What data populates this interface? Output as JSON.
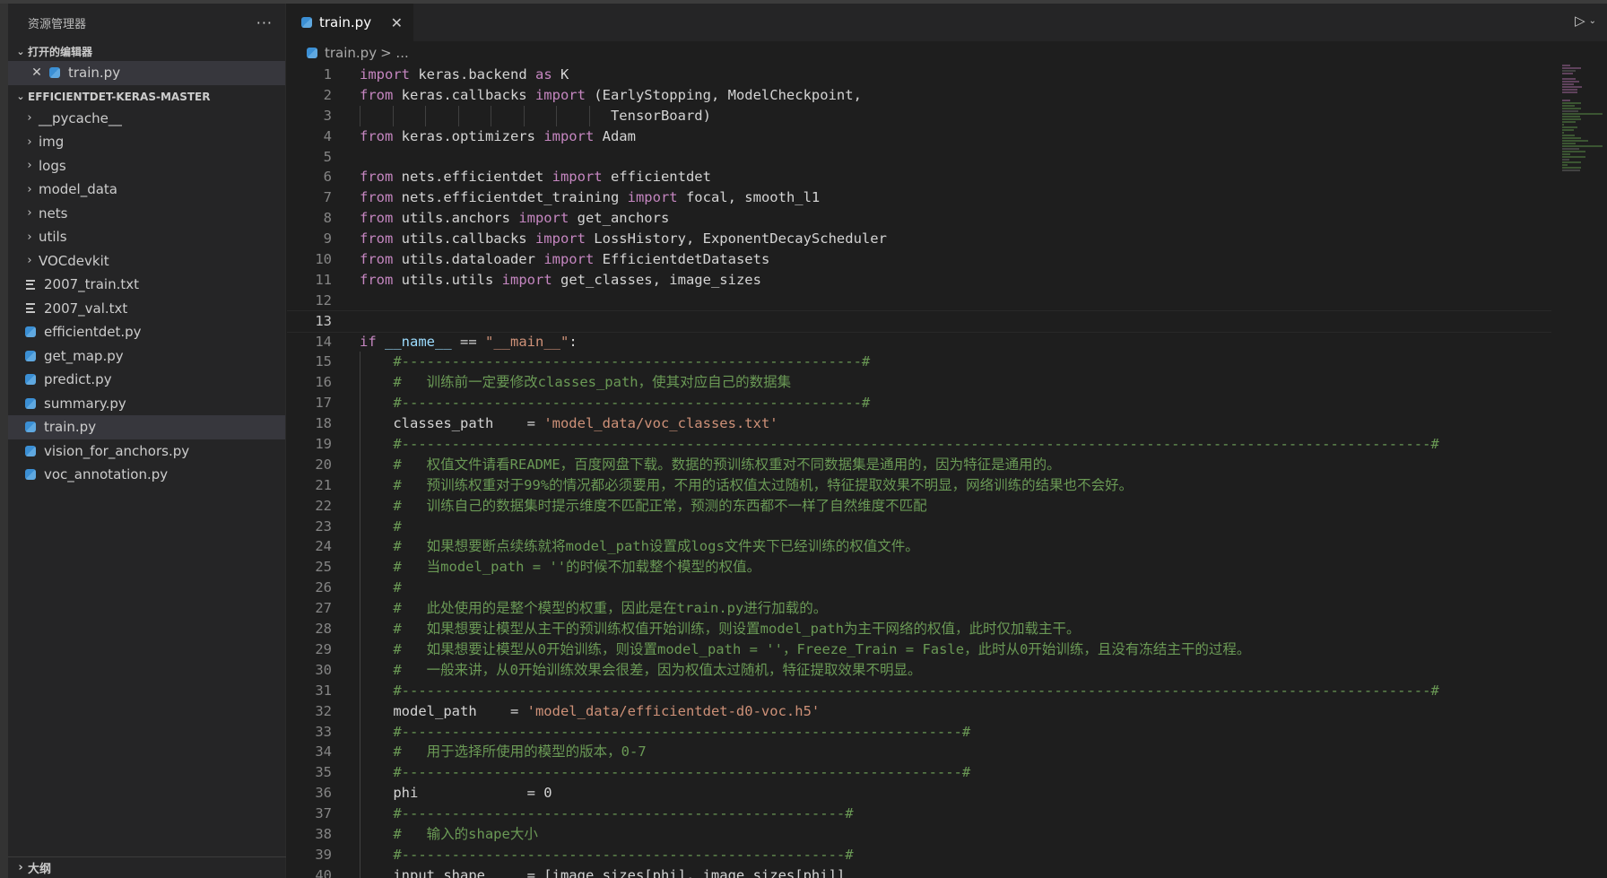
{
  "sidebar": {
    "title": "资源管理器",
    "more": "···",
    "open_editors": {
      "label": "打开的编辑器",
      "items": [
        {
          "name": "train.py"
        }
      ]
    },
    "project": {
      "label": "EFFICIENTDET-KERAS-MASTER",
      "items": [
        {
          "name": "__pycache__",
          "type": "folder"
        },
        {
          "name": "img",
          "type": "folder"
        },
        {
          "name": "logs",
          "type": "folder"
        },
        {
          "name": "model_data",
          "type": "folder"
        },
        {
          "name": "nets",
          "type": "folder"
        },
        {
          "name": "utils",
          "type": "folder"
        },
        {
          "name": "VOCdevkit",
          "type": "folder"
        },
        {
          "name": "2007_train.txt",
          "type": "txt"
        },
        {
          "name": "2007_val.txt",
          "type": "txt"
        },
        {
          "name": "efficientdet.py",
          "type": "py"
        },
        {
          "name": "get_map.py",
          "type": "py"
        },
        {
          "name": "predict.py",
          "type": "py"
        },
        {
          "name": "summary.py",
          "type": "py"
        },
        {
          "name": "train.py",
          "type": "py",
          "active": true
        },
        {
          "name": "vision_for_anchors.py",
          "type": "py"
        },
        {
          "name": "voc_annotation.py",
          "type": "py"
        }
      ]
    },
    "outline_label": "大纲"
  },
  "tab": {
    "label": "train.py"
  },
  "breadcrumb": {
    "file": "train.py",
    "rest": "> ..."
  },
  "editor": {
    "current_line": 13,
    "lines": [
      {
        "n": "1",
        "tokens": [
          {
            "t": "import",
            "c": "kw"
          },
          {
            "t": " keras.backend "
          },
          {
            "t": "as",
            "c": "kw"
          },
          {
            "t": " K"
          }
        ]
      },
      {
        "n": "2",
        "tokens": [
          {
            "t": "from",
            "c": "kw"
          },
          {
            "t": " keras.callbacks "
          },
          {
            "t": "import",
            "c": "kw"
          },
          {
            "t": " (EarlyStopping, ModelCheckpoint,"
          }
        ]
      },
      {
        "n": "3",
        "tokens": [
          {
            "t": "                              TensorBoard)"
          }
        ]
      },
      {
        "n": "4",
        "tokens": [
          {
            "t": "from",
            "c": "kw"
          },
          {
            "t": " keras.optimizers "
          },
          {
            "t": "import",
            "c": "kw"
          },
          {
            "t": " Adam"
          }
        ]
      },
      {
        "n": "5",
        "tokens": []
      },
      {
        "n": "6",
        "tokens": [
          {
            "t": "from",
            "c": "kw"
          },
          {
            "t": " nets.efficientdet "
          },
          {
            "t": "import",
            "c": "kw"
          },
          {
            "t": " efficientdet"
          }
        ]
      },
      {
        "n": "7",
        "tokens": [
          {
            "t": "from",
            "c": "kw"
          },
          {
            "t": " nets.efficientdet_training "
          },
          {
            "t": "import",
            "c": "kw"
          },
          {
            "t": " focal, smooth_l1"
          }
        ]
      },
      {
        "n": "8",
        "tokens": [
          {
            "t": "from",
            "c": "kw"
          },
          {
            "t": " utils.anchors "
          },
          {
            "t": "import",
            "c": "kw"
          },
          {
            "t": " get_anchors"
          }
        ]
      },
      {
        "n": "9",
        "tokens": [
          {
            "t": "from",
            "c": "kw"
          },
          {
            "t": " utils.callbacks "
          },
          {
            "t": "import",
            "c": "kw"
          },
          {
            "t": " LossHistory, ExponentDecayScheduler"
          }
        ]
      },
      {
        "n": "10",
        "tokens": [
          {
            "t": "from",
            "c": "kw"
          },
          {
            "t": " utils.dataloader "
          },
          {
            "t": "import",
            "c": "kw"
          },
          {
            "t": " EfficientdetDatasets"
          }
        ]
      },
      {
        "n": "11",
        "tokens": [
          {
            "t": "from",
            "c": "kw"
          },
          {
            "t": " utils.utils "
          },
          {
            "t": "import",
            "c": "kw"
          },
          {
            "t": " get_classes, image_sizes"
          }
        ]
      },
      {
        "n": "12",
        "tokens": []
      },
      {
        "n": "13",
        "tokens": []
      },
      {
        "n": "14",
        "tokens": [
          {
            "t": "if",
            "c": "kw"
          },
          {
            "t": " "
          },
          {
            "t": "__name__",
            "c": "var"
          },
          {
            "t": " == "
          },
          {
            "t": "\"__main__\"",
            "c": "str"
          },
          {
            "t": ":"
          }
        ]
      },
      {
        "n": "15",
        "tokens": [
          {
            "t": "    "
          },
          {
            "t": "#-------------------------------------------------------#",
            "c": "cm"
          }
        ]
      },
      {
        "n": "16",
        "tokens": [
          {
            "t": "    "
          },
          {
            "t": "#   训练前一定要修改classes_path，使其对应自己的数据集",
            "c": "cm"
          }
        ]
      },
      {
        "n": "17",
        "tokens": [
          {
            "t": "    "
          },
          {
            "t": "#-------------------------------------------------------#",
            "c": "cm"
          }
        ]
      },
      {
        "n": "18",
        "tokens": [
          {
            "t": "    classes_path    = "
          },
          {
            "t": "'model_data/voc_classes.txt'",
            "c": "str"
          }
        ]
      },
      {
        "n": "19",
        "tokens": [
          {
            "t": "    "
          },
          {
            "t": "#---------------------------------------------------------------------------------------------------------------------------#",
            "c": "cm"
          }
        ]
      },
      {
        "n": "20",
        "tokens": [
          {
            "t": "    "
          },
          {
            "t": "#   权值文件请看README，百度网盘下载。数据的预训练权重对不同数据集是通用的，因为特征是通用的。",
            "c": "cm"
          }
        ]
      },
      {
        "n": "21",
        "tokens": [
          {
            "t": "    "
          },
          {
            "t": "#   预训练权重对于99%的情况都必须要用，不用的话权值太过随机，特征提取效果不明显，网络训练的结果也不会好。",
            "c": "cm"
          }
        ]
      },
      {
        "n": "22",
        "tokens": [
          {
            "t": "    "
          },
          {
            "t": "#   训练自己的数据集时提示维度不匹配正常，预测的东西都不一样了自然维度不匹配",
            "c": "cm"
          }
        ]
      },
      {
        "n": "23",
        "tokens": [
          {
            "t": "    "
          },
          {
            "t": "#",
            "c": "cm"
          }
        ]
      },
      {
        "n": "24",
        "tokens": [
          {
            "t": "    "
          },
          {
            "t": "#   如果想要断点续练就将model_path设置成logs文件夹下已经训练的权值文件。",
            "c": "cm"
          }
        ]
      },
      {
        "n": "25",
        "tokens": [
          {
            "t": "    "
          },
          {
            "t": "#   当model_path = ''的时候不加载整个模型的权值。",
            "c": "cm"
          }
        ]
      },
      {
        "n": "26",
        "tokens": [
          {
            "t": "    "
          },
          {
            "t": "#",
            "c": "cm"
          }
        ]
      },
      {
        "n": "27",
        "tokens": [
          {
            "t": "    "
          },
          {
            "t": "#   此处使用的是整个模型的权重，因此是在train.py进行加载的。",
            "c": "cm"
          }
        ]
      },
      {
        "n": "28",
        "tokens": [
          {
            "t": "    "
          },
          {
            "t": "#   如果想要让模型从主干的预训练权值开始训练，则设置model_path为主干网络的权值，此时仅加载主干。",
            "c": "cm"
          }
        ]
      },
      {
        "n": "29",
        "tokens": [
          {
            "t": "    "
          },
          {
            "t": "#   如果想要让模型从0开始训练，则设置model_path = ''，Freeze_Train = Fasle，此时从0开始训练，且没有冻结主干的过程。",
            "c": "cm"
          }
        ]
      },
      {
        "n": "30",
        "tokens": [
          {
            "t": "    "
          },
          {
            "t": "#   一般来讲，从0开始训练效果会很差，因为权值太过随机，特征提取效果不明显。",
            "c": "cm"
          }
        ]
      },
      {
        "n": "31",
        "tokens": [
          {
            "t": "    "
          },
          {
            "t": "#---------------------------------------------------------------------------------------------------------------------------#",
            "c": "cm"
          }
        ]
      },
      {
        "n": "32",
        "tokens": [
          {
            "t": "    model_path    = "
          },
          {
            "t": "'model_data/efficientdet-d0-voc.h5'",
            "c": "str"
          }
        ]
      },
      {
        "n": "33",
        "tokens": [
          {
            "t": "    "
          },
          {
            "t": "#-------------------------------------------------------------------#",
            "c": "cm"
          }
        ]
      },
      {
        "n": "34",
        "tokens": [
          {
            "t": "    "
          },
          {
            "t": "#   用于选择所使用的模型的版本，0-7",
            "c": "cm"
          }
        ]
      },
      {
        "n": "35",
        "tokens": [
          {
            "t": "    "
          },
          {
            "t": "#-------------------------------------------------------------------#",
            "c": "cm"
          }
        ]
      },
      {
        "n": "36",
        "tokens": [
          {
            "t": "    phi             = 0"
          }
        ]
      },
      {
        "n": "37",
        "tokens": [
          {
            "t": "    "
          },
          {
            "t": "#-----------------------------------------------------#",
            "c": "cm"
          }
        ]
      },
      {
        "n": "38",
        "tokens": [
          {
            "t": "    "
          },
          {
            "t": "#   输入的shape大小",
            "c": "cm"
          }
        ]
      },
      {
        "n": "39",
        "tokens": [
          {
            "t": "    "
          },
          {
            "t": "#-----------------------------------------------------#",
            "c": "cm"
          }
        ]
      },
      {
        "n": "40",
        "tokens": [
          {
            "t": "    input_shape     = [image_sizes[phi], image_sizes[phi]]"
          }
        ]
      }
    ]
  }
}
